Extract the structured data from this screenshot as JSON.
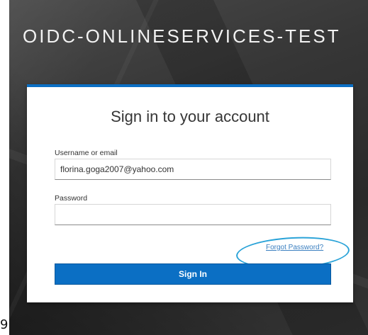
{
  "page": {
    "stray_char": "9"
  },
  "header": {
    "realm_title": "OIDC-ONLINESERVICES-TEST"
  },
  "login_form": {
    "title": "Sign in to your account",
    "username_label": "Username or email",
    "username_value": "florina.goga2007@yahoo.com",
    "password_label": "Password",
    "password_value": "",
    "forgot_password_link": "Forgot Password?",
    "sign_in_button": "Sign In"
  },
  "colors": {
    "accent": "#0b6fc4",
    "annotation": "#2aa3d8",
    "link": "#3a7fc0",
    "background_dark": "#363636"
  }
}
